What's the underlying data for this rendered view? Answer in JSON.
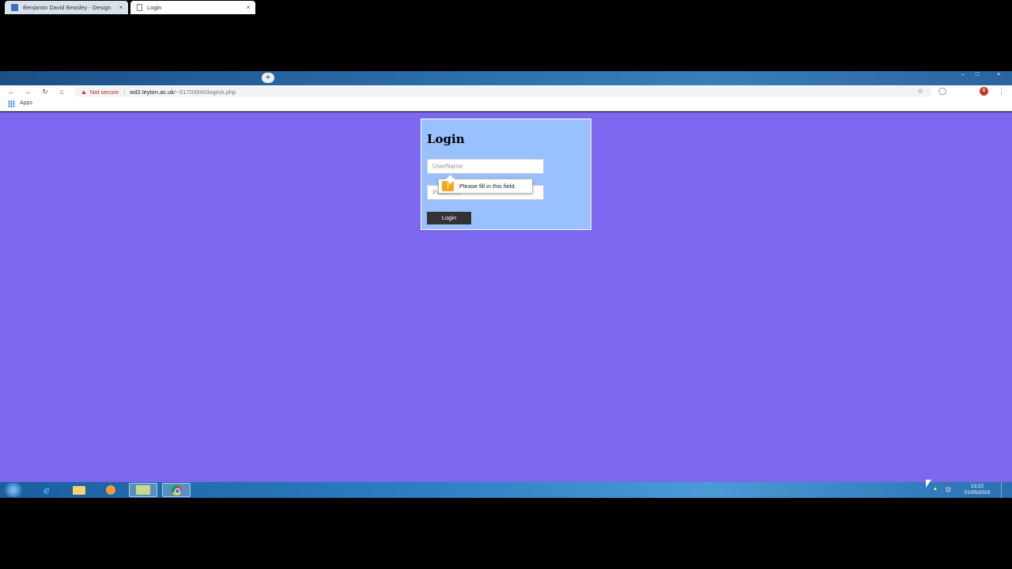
{
  "browser": {
    "tabs": [
      {
        "title": "Benjamin David Beasley - Design"
      },
      {
        "title": "Login"
      }
    ],
    "tab_close": "×",
    "new_tab": "+",
    "window_controls": [
      "–",
      "□",
      "×"
    ],
    "nav": {
      "back": "←",
      "forward": "→",
      "reload": "↻",
      "home": "⌂"
    },
    "address": {
      "security_icon": "warning-icon",
      "security_label": "Not secure",
      "separator": "|",
      "host": "wd2.leyton.ac.uk",
      "path": "/~S1703940/loginA.php"
    },
    "star": "☆",
    "extension": "◯",
    "profile_initial": "B",
    "menu": "⋮",
    "bookmarks": {
      "apps_label": "Apps"
    }
  },
  "page": {
    "background": "#7b68ee",
    "card_background": "#99c0ff",
    "title": "Login",
    "username_placeholder": "UserName",
    "password_placeholder": "Password",
    "login_button": "Login",
    "validation": {
      "icon": "!",
      "message": "Please fill in this field."
    }
  },
  "taskbar": {
    "ie_glyph": "e",
    "tray_up": "▲",
    "tray_network": "⊡",
    "time": "13:22",
    "date": "01/05/2019"
  }
}
